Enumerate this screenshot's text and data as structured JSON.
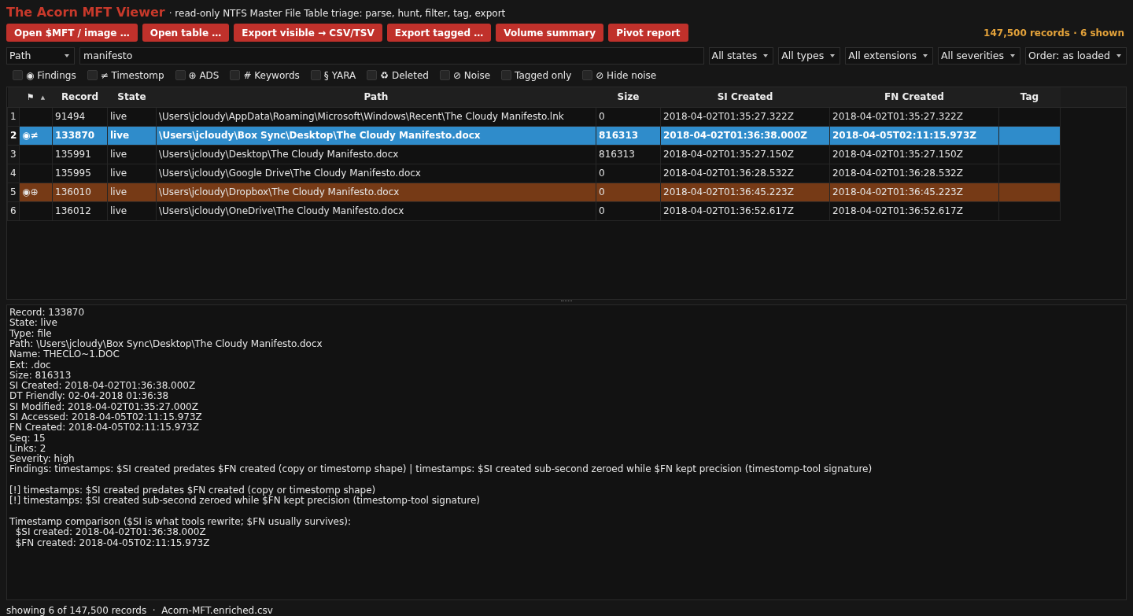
{
  "app": {
    "title": "The Acorn MFT Viewer",
    "subtitle": "· read-only NTFS Master File Table triage: parse, hunt, filter, tag, export"
  },
  "toolbar": {
    "buttons": [
      "Open $MFT / image …",
      "Open table …",
      "Export visible → CSV/TSV",
      "Export tagged …",
      "Volume summary",
      "Pivot report"
    ],
    "record_count": "147,500 records · 6 shown"
  },
  "filters": {
    "field": "Path",
    "search": {
      "value": "manifesto"
    },
    "dropdowns": [
      "All states",
      "All types",
      "All extensions",
      "All severities",
      "Order: as loaded"
    ]
  },
  "toggles": [
    {
      "label": "◉ Findings",
      "checked": false
    },
    {
      "label": "≠ Timestomp",
      "checked": false
    },
    {
      "label": "⊕ ADS",
      "checked": false
    },
    {
      "label": "# Keywords",
      "checked": false
    },
    {
      "label": "§ YARA",
      "checked": false
    },
    {
      "label": "♻ Deleted",
      "checked": false
    },
    {
      "label": "⊘ Noise",
      "checked": false
    },
    {
      "label": "Tagged only",
      "checked": false
    },
    {
      "label": "⊘ Hide noise",
      "checked": false
    }
  ],
  "table": {
    "columns": [
      "⚑",
      "Record",
      "State",
      "Path",
      "Size",
      "SI Created",
      "FN Created",
      "Tag"
    ],
    "sort_marker": "▲",
    "rows": [
      {
        "index": "1",
        "flags": "",
        "record": "91494",
        "state": "live",
        "path": "\\Users\\jcloudy\\AppData\\Roaming\\Microsoft\\Windows\\Recent\\The Cloudy Manifesto.lnk",
        "size": "0",
        "si_created": "2018-04-02T01:35:27.322Z",
        "fn_created": "2018-04-02T01:35:27.322Z",
        "selected": false,
        "highlighted": false
      },
      {
        "index": "2",
        "flags": "◉≠",
        "record": "133870",
        "state": "live",
        "path": "\\Users\\jcloudy\\Box Sync\\Desktop\\The Cloudy Manifesto.docx",
        "size": "816313",
        "si_created": "2018-04-02T01:36:38.000Z",
        "fn_created": "2018-04-05T02:11:15.973Z",
        "selected": true,
        "highlighted": false
      },
      {
        "index": "3",
        "flags": "",
        "record": "135991",
        "state": "live",
        "path": "\\Users\\jcloudy\\Desktop\\The Cloudy Manifesto.docx",
        "size": "816313",
        "si_created": "2018-04-02T01:35:27.150Z",
        "fn_created": "2018-04-02T01:35:27.150Z",
        "selected": false,
        "highlighted": false
      },
      {
        "index": "4",
        "flags": "",
        "record": "135995",
        "state": "live",
        "path": "\\Users\\jcloudy\\Google Drive\\The Cloudy Manifesto.docx",
        "size": "0",
        "si_created": "2018-04-02T01:36:28.532Z",
        "fn_created": "2018-04-02T01:36:28.532Z",
        "selected": false,
        "highlighted": false
      },
      {
        "index": "5",
        "flags": "◉⊕",
        "record": "136010",
        "state": "live",
        "path": "\\Users\\jcloudy\\Dropbox\\The Cloudy Manifesto.docx",
        "size": "0",
        "si_created": "2018-04-02T01:36:45.223Z",
        "fn_created": "2018-04-02T01:36:45.223Z",
        "selected": false,
        "highlighted": true
      },
      {
        "index": "6",
        "flags": "",
        "record": "136012",
        "state": "live",
        "path": "\\Users\\jcloudy\\OneDrive\\The Cloudy Manifesto.docx",
        "size": "0",
        "si_created": "2018-04-02T01:36:52.617Z",
        "fn_created": "2018-04-02T01:36:52.617Z",
        "selected": false,
        "highlighted": false
      }
    ]
  },
  "detail": [
    [
      "Record: 133870",
      "State: live",
      "Type: file",
      "Path: \\Users\\jcloudy\\Box Sync\\Desktop\\The Cloudy Manifesto.docx",
      "Name: THECLO~1.DOC",
      "Ext: .doc",
      "Size: 816313",
      "SI Created: 2018-04-02T01:36:38.000Z",
      "DT Friendly: 02-04-2018 01:36:38",
      "SI Modified: 2018-04-02T01:35:27.000Z",
      "SI Accessed: 2018-04-05T02:11:15.973Z",
      "FN Created: 2018-04-05T02:11:15.973Z",
      "Seq: 15",
      "Links: 2",
      "Severity: high",
      "Findings: timestamps: $SI created predates $FN created (copy or timestomp shape) | timestamps: $SI created sub-second zeroed while $FN kept precision (timestomp-tool signature)"
    ],
    [
      "[!] timestamps: $SI created predates $FN created (copy or timestomp shape)",
      "[!] timestamps: $SI created sub-second zeroed while $FN kept precision (timestomp-tool signature)"
    ],
    [
      "Timestamp comparison ($SI is what tools rewrite; $FN usually survives):",
      "  $SI created: 2018-04-02T01:36:38.000Z",
      "  $FN created: 2018-04-05T02:11:15.973Z"
    ]
  ],
  "status_bar": "showing 6 of 147,500 records  ·  Acorn-MFT.enriched.csv"
}
